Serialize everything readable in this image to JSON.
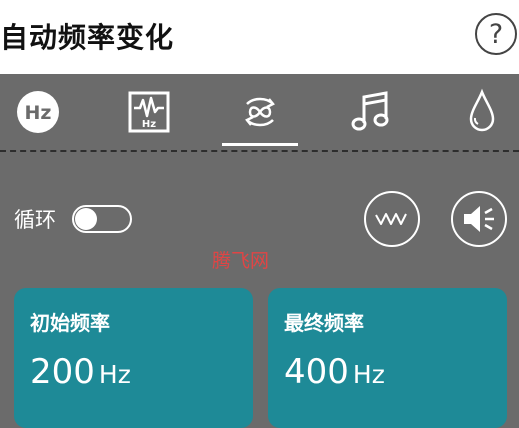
{
  "header": {
    "title": "自动频率变化",
    "help_glyph": "?"
  },
  "tabs": [
    {
      "name": "hz-icon",
      "label": "Hz"
    },
    {
      "name": "waveform-hz-icon",
      "label": "Hz"
    },
    {
      "name": "loop-icon",
      "selected": true
    },
    {
      "name": "music-note-icon"
    },
    {
      "name": "water-drop-icon"
    }
  ],
  "controls": {
    "loop_label": "循环",
    "loop_enabled": false,
    "wave_button": "waveform-icon",
    "speaker_button": "speaker-icon"
  },
  "watermark": "腾飞网",
  "cards": {
    "start": {
      "label": "初始频率",
      "value": "200",
      "unit": "Hz"
    },
    "end": {
      "label": "最终频率",
      "value": "400",
      "unit": "Hz"
    }
  },
  "colors": {
    "background": "#6b6b6b",
    "header": "#ffffff",
    "card": "#1e8a97",
    "watermark": "#e04545"
  }
}
